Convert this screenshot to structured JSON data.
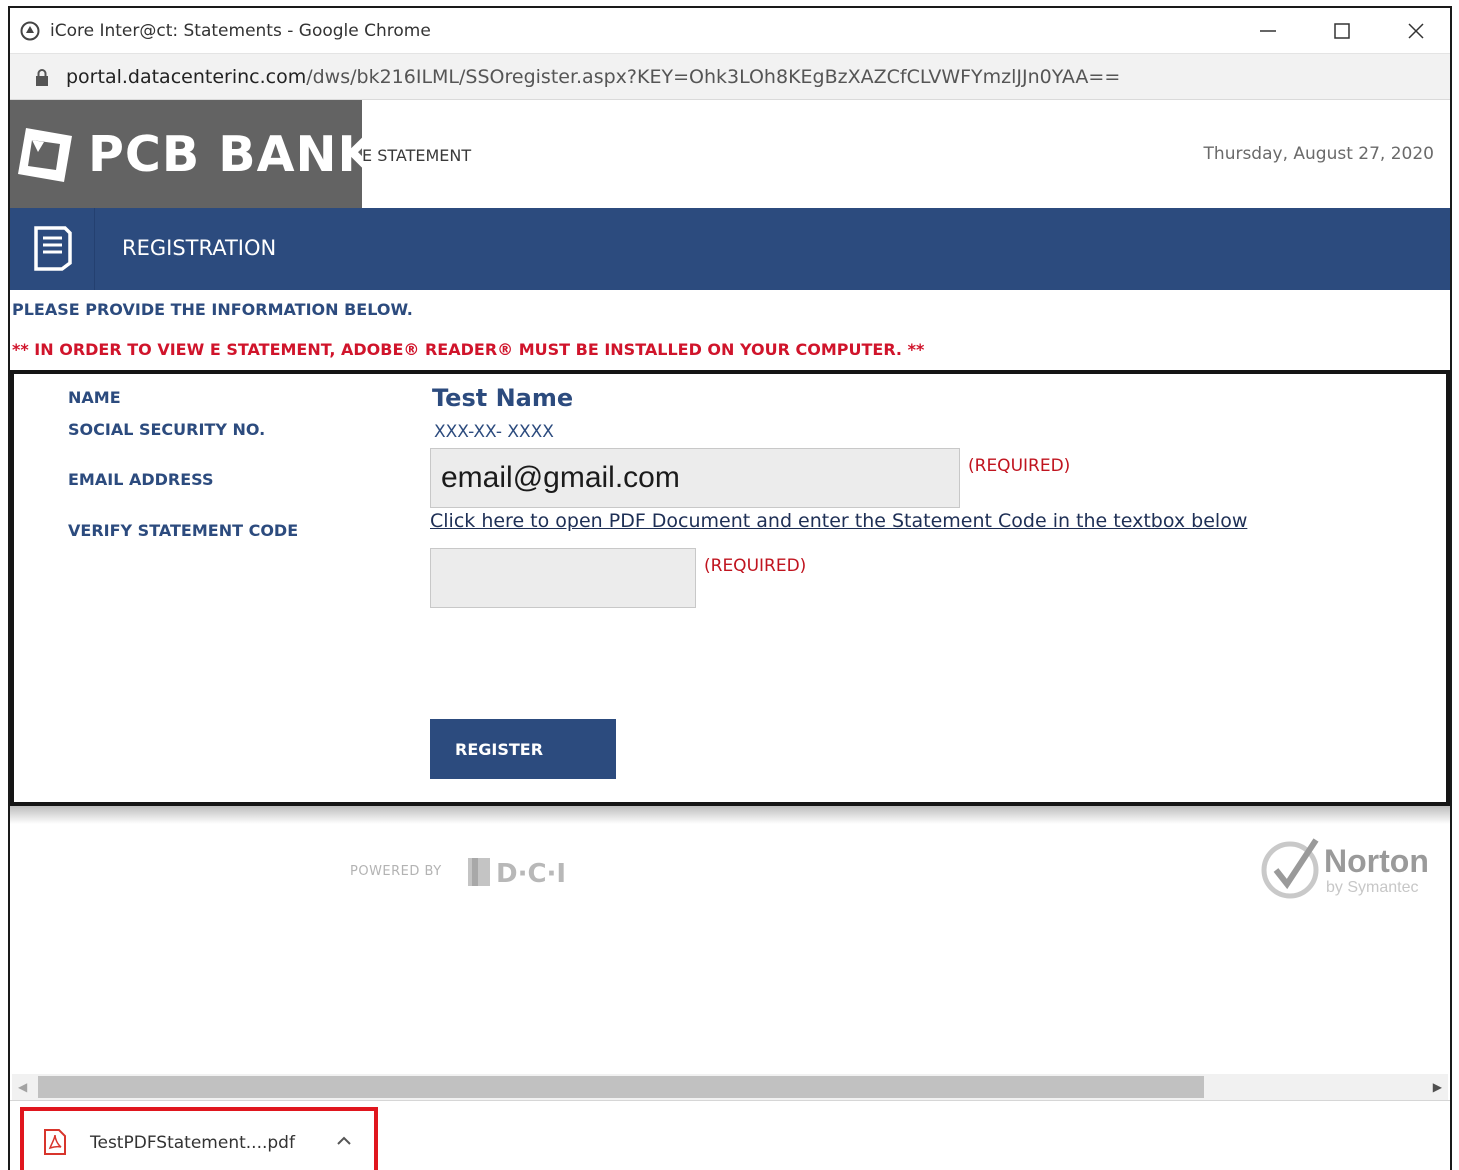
{
  "browser": {
    "window_title": "iCore Inter@ct: Statements - Google Chrome",
    "url_host": "portal.datacenterinc.com",
    "url_path": "/dws/bk216ILML/SSOregister.aspx?KEY=Ohk3LOh8KEgBzXAZCfCLVWFYmzlJJn0YAA=="
  },
  "header": {
    "bank_name": "PCB BANK",
    "subtitle": "E STATEMENT",
    "date": "Thursday, August 27, 2020"
  },
  "registration": {
    "title": "REGISTRATION",
    "info": "PLEASE PROVIDE THE INFORMATION BELOW.",
    "warning": "** IN ORDER TO VIEW E STATEMENT, ADOBE® READER® MUST BE INSTALLED ON YOUR COMPUTER. **"
  },
  "form": {
    "labels": {
      "name": "NAME",
      "ssn": "SOCIAL SECURITY NO.",
      "email": "EMAIL ADDRESS",
      "code": "VERIFY STATEMENT CODE"
    },
    "name_value": "Test Name",
    "ssn_value": "XXX-XX- XXXX",
    "email_value": "email@gmail.com",
    "required_label": "(REQUIRED)",
    "pdf_link": "Click here to open PDF Document and enter the Statement Code in the textbox below",
    "code_value": "",
    "register_label": "REGISTER"
  },
  "footer": {
    "powered_by": "POWERED BY",
    "powered_logo": "D·C·I",
    "norton_name": "Norton",
    "norton_sub": "by Symantec"
  },
  "download": {
    "filename": "TestPDFStatement....pdf"
  },
  "colors": {
    "brand_blue": "#2c4b7e",
    "required_red": "#c0141f",
    "logo_gray": "#636363"
  }
}
